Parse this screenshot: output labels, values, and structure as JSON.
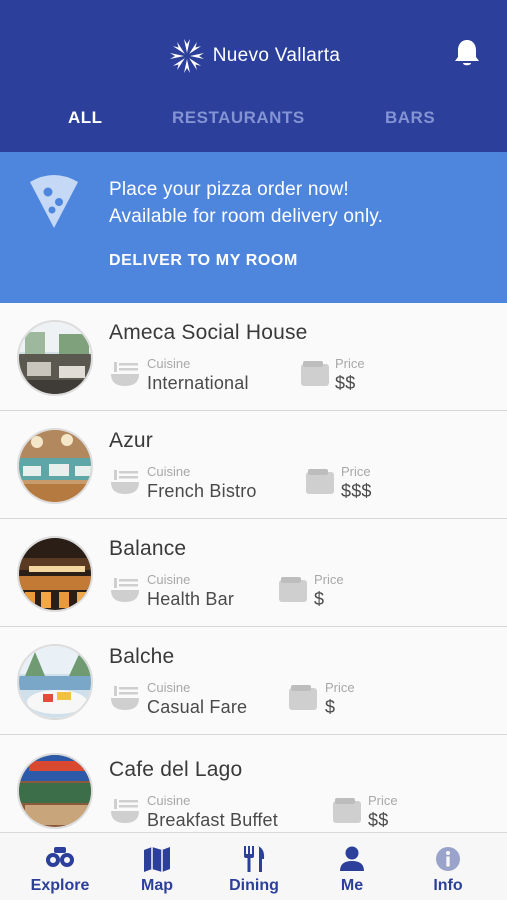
{
  "header": {
    "title": "Nuevo Vallarta",
    "tabs": [
      {
        "label": "ALL",
        "active": true
      },
      {
        "label": "RESTAURANTS",
        "active": false
      },
      {
        "label": "BARS",
        "active": false
      }
    ]
  },
  "promo": {
    "line1": "Place your pizza order now!",
    "line2": "Available for room delivery only.",
    "cta": "DELIVER TO MY ROOM"
  },
  "restaurants": [
    {
      "name": "Ameca Social House",
      "cuisine_label": "Cuisine",
      "cuisine": "International",
      "price_label": "Price",
      "price": "$$"
    },
    {
      "name": "Azur",
      "cuisine_label": "Cuisine",
      "cuisine": "French Bistro",
      "price_label": "Price",
      "price": "$$$"
    },
    {
      "name": "Balance",
      "cuisine_label": "Cuisine",
      "cuisine": "Health Bar",
      "price_label": "Price",
      "price": "$"
    },
    {
      "name": "Balche",
      "cuisine_label": "Cuisine",
      "cuisine": "Casual Fare",
      "price_label": "Price",
      "price": "$"
    },
    {
      "name": "Cafe del Lago",
      "cuisine_label": "Cuisine",
      "cuisine": "Breakfast Buffet",
      "price_label": "Price",
      "price": "$$"
    }
  ],
  "nav": [
    {
      "label": "Explore",
      "icon": "binoculars-icon"
    },
    {
      "label": "Map",
      "icon": "map-icon"
    },
    {
      "label": "Dining",
      "icon": "fork-knife-icon"
    },
    {
      "label": "Me",
      "icon": "person-icon"
    },
    {
      "label": "Info",
      "icon": "info-icon"
    }
  ],
  "colors": {
    "header": "#2b3f9b",
    "promo": "#4f86dd",
    "tab_inactive": "#8393d3"
  }
}
